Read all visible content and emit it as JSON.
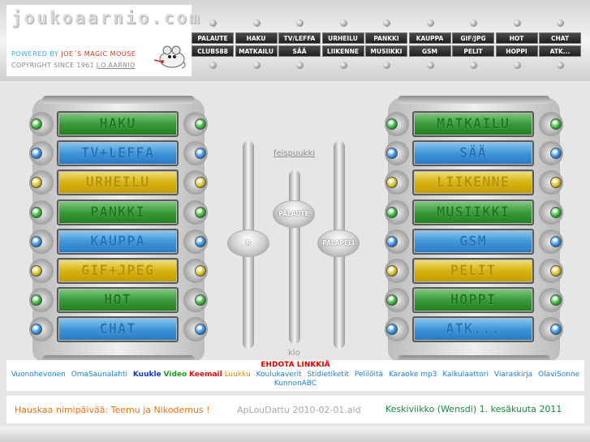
{
  "header": {
    "logo_text": "joukoaarnio.com",
    "powered_prefix": "POWERED BY",
    "powered_owner": "JOE´S",
    "powered_suffix": "MAGIC MOUSE",
    "copyright_prefix": "COPYRIGHT SINCE 1961",
    "copyright_owner": "J.O.AARNIO"
  },
  "nav": {
    "row1": [
      "PALAUTE",
      "HAKU",
      "TV/LEFFA",
      "URHEILU",
      "PANKKI",
      "KAUPPA",
      "GIF/JPG",
      "HOT",
      "CHAT"
    ],
    "row2": [
      "CLUBS88",
      "MATKAILU",
      "SÄÄ",
      "LIIKENNE",
      "MUSIIKKI",
      "GSM",
      "PELIT",
      "HOPPI",
      "ATK..."
    ]
  },
  "left_panel": [
    {
      "label": "HAKU",
      "color": "green"
    },
    {
      "label": "TV+LEFFA",
      "color": "blue"
    },
    {
      "label": "URHEILU",
      "color": "yellow"
    },
    {
      "label": "PANKKI",
      "color": "green"
    },
    {
      "label": "KAUPPA",
      "color": "blue"
    },
    {
      "label": "GIF+JPEG",
      "color": "yellow"
    },
    {
      "label": "HOT",
      "color": "green"
    },
    {
      "label": "CHAT",
      "color": "blue"
    }
  ],
  "right_panel": [
    {
      "label": "MATKAILU",
      "color": "green"
    },
    {
      "label": "SÄÄ",
      "color": "blue"
    },
    {
      "label": "LIIKENNE",
      "color": "yellow"
    },
    {
      "label": "MUSIIKKI",
      "color": "green"
    },
    {
      "label": "GSM",
      "color": "blue"
    },
    {
      "label": "PELIT",
      "color": "yellow"
    },
    {
      "label": "HOPPI",
      "color": "green"
    },
    {
      "label": "ATK...",
      "color": "blue"
    }
  ],
  "ball_colors": {
    "green": "#2fb52f",
    "blue": "#2a8ee6",
    "yellow": "#d8c21a"
  },
  "center": {
    "top_link": "feispuukki",
    "left_knob": "R",
    "middle_knob": "PALAUTE",
    "right_knob": "PALAPELI",
    "bottom_text": "klo"
  },
  "links": {
    "title": "EHDOTA LINKKIÄ",
    "items_before": [
      "Vuonohevonen",
      "OmaSaunalahti"
    ],
    "kuukle": [
      "Kuukle",
      "Video",
      "Keemail",
      "Luukku"
    ],
    "items_after": [
      "Koulukaverit",
      "Stidietiketit",
      "Pelilöitä",
      "Karaoke mp3",
      "Kalkulaattori",
      "Viaraskirja",
      "OlaviSonne",
      "KunnonABC"
    ]
  },
  "footer": {
    "name_day": "Hauskaa nimipäivää: Teemu ja Nikodemus !",
    "updated": "ApLouDattu 2010-02-01.ald",
    "date": "Keskiviikko (Wensdi)  1. kesäkuuta 2011"
  }
}
